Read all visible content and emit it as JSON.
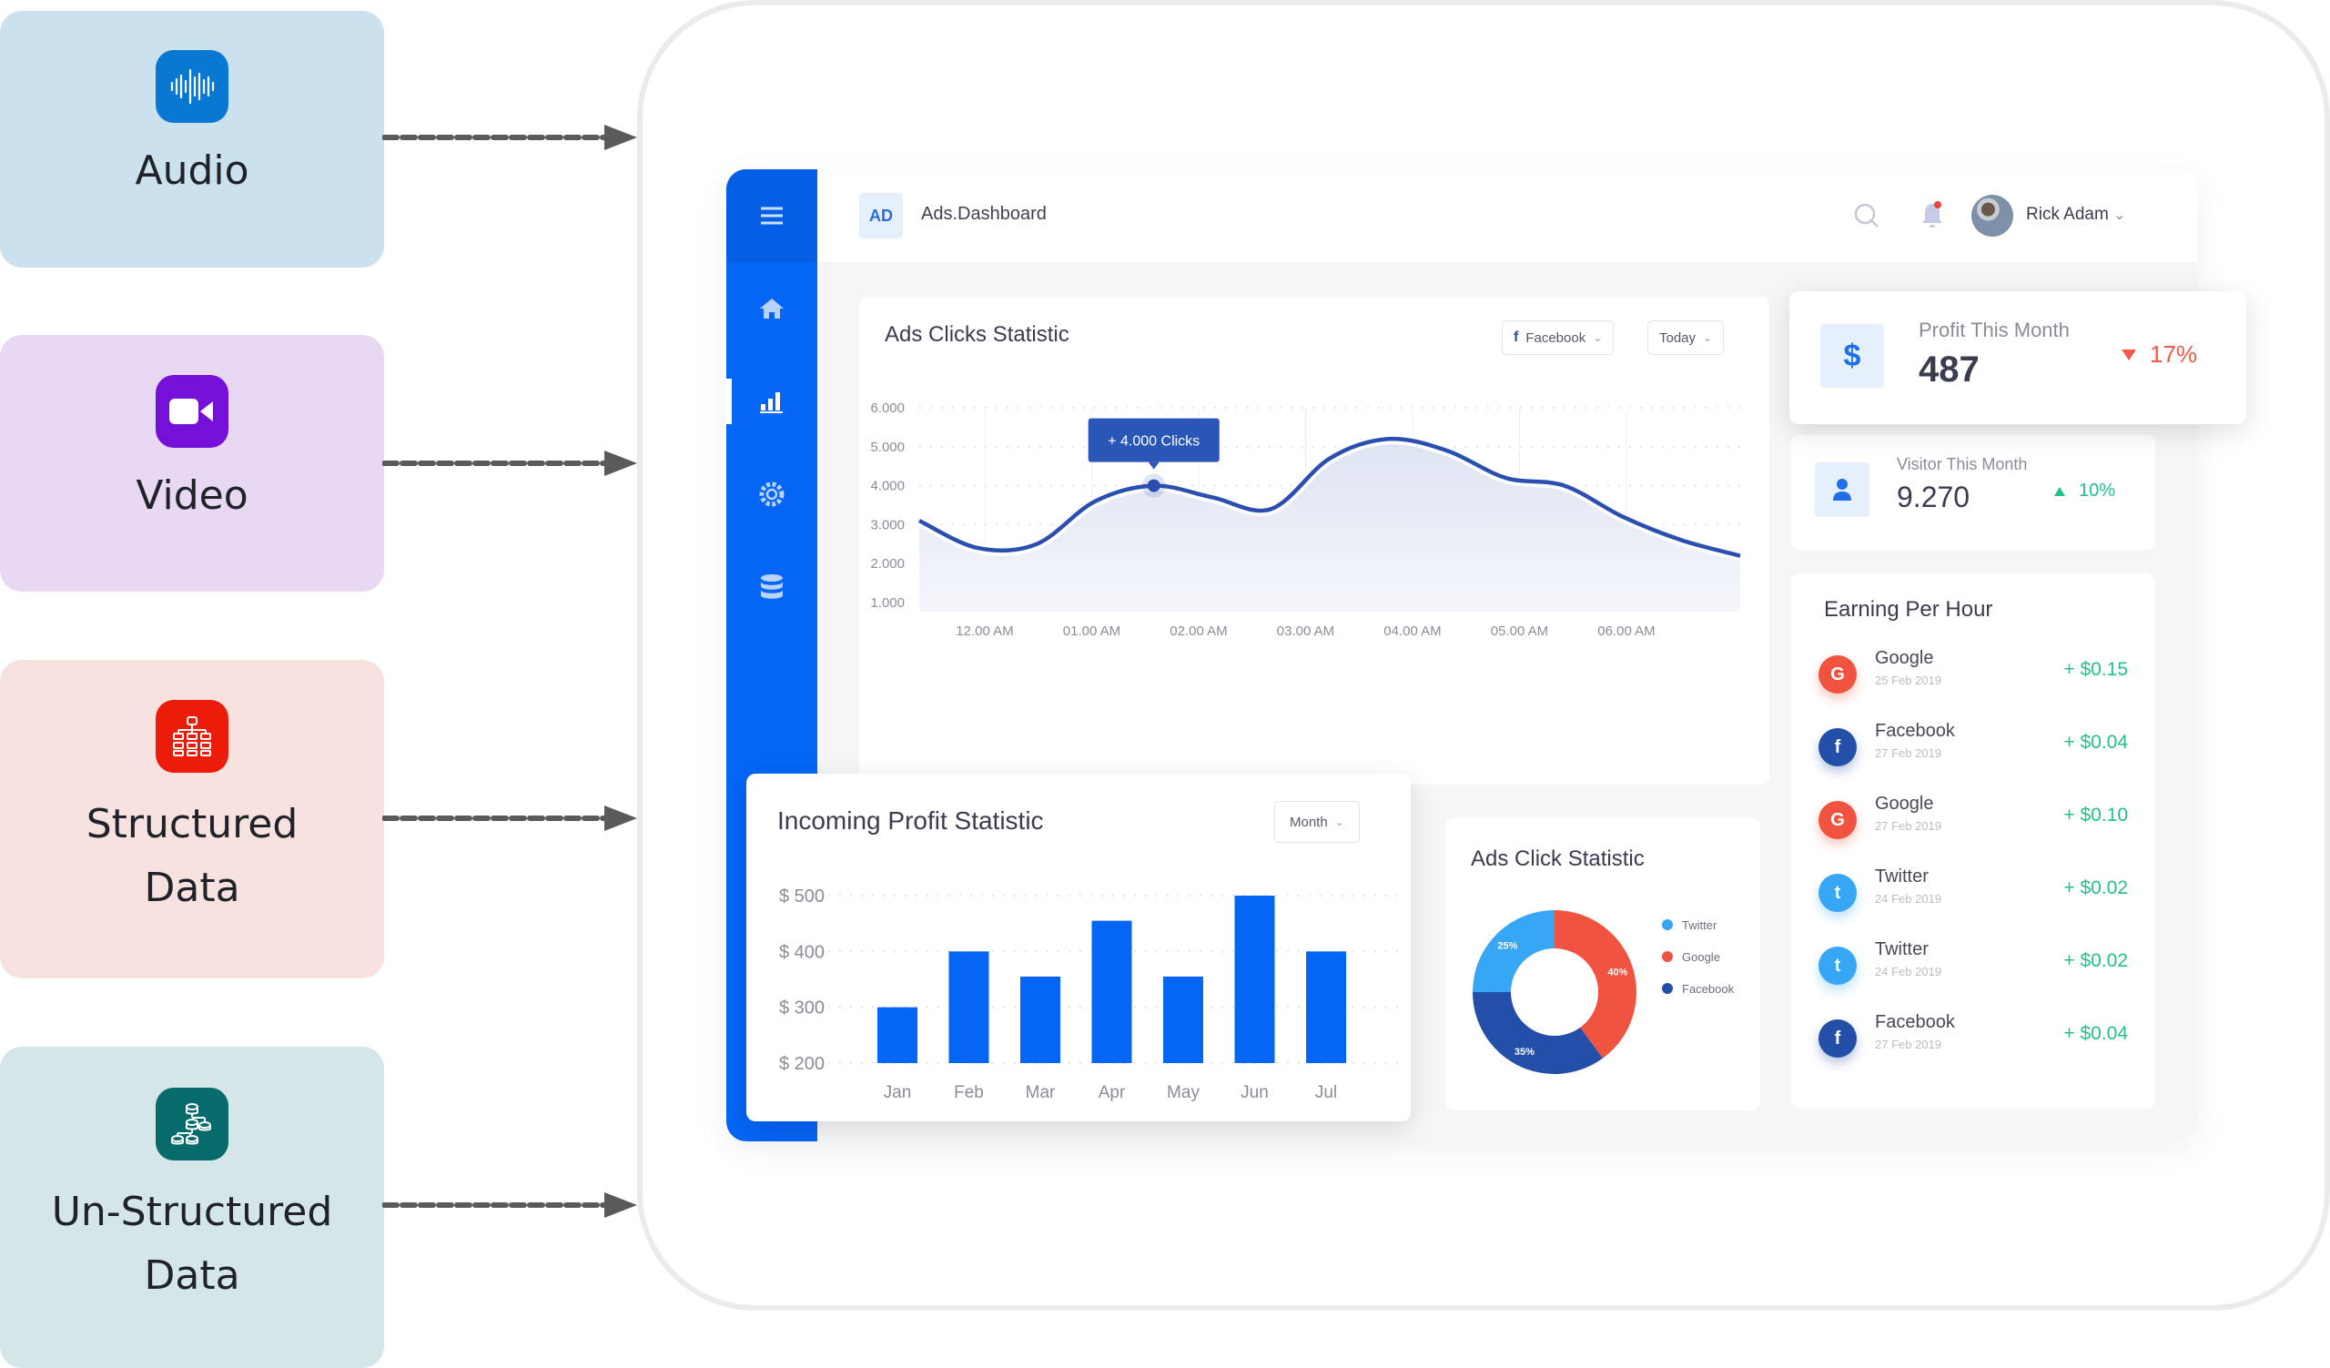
{
  "sources": [
    {
      "id": "audio",
      "label": "Audio",
      "icon": "audio-waveform-icon",
      "color": "#0978d2",
      "bg": "#cbe1ee"
    },
    {
      "id": "video",
      "label": "Video",
      "icon": "video-camera-icon",
      "color": "#7510d9",
      "bg": "#e8d8f3"
    },
    {
      "id": "structured",
      "label": "Structured Data",
      "label_lines": [
        "Structured",
        "Data"
      ],
      "icon": "structured-hierarchy-icon",
      "color": "#eb1c0a",
      "bg": "#f8e2df"
    },
    {
      "id": "unstructured",
      "label": "Un-Structured Data",
      "label_lines": [
        "Un-Structured",
        "Data"
      ],
      "icon": "unstructured-database-tree-icon",
      "color": "#076b6b",
      "bg": "#d4e6e8"
    }
  ],
  "dashboard": {
    "logo_badge": "AD",
    "app_title": "Ads.Dashboard",
    "user_name": "Rick Adam",
    "accent": "#0565f5",
    "sidebar": [
      {
        "icon": "menu-icon"
      },
      {
        "icon": "home-icon"
      },
      {
        "icon": "bar-chart-icon",
        "active": true
      },
      {
        "icon": "settings-gear-icon"
      },
      {
        "icon": "database-icon"
      }
    ],
    "ads_clicks": {
      "title": "Ads Clicks Statistic",
      "filter_source": "Facebook",
      "filter_period": "Today",
      "tooltip": "+ 4.000 Clicks"
    },
    "incoming_profit": {
      "title": "Incoming Profit Statistic",
      "filter": "Month"
    },
    "ads_click_pie": {
      "title": "Ads Click Statistic"
    },
    "profit_month": {
      "label": "Profit This Month",
      "value": "487",
      "delta": "17%",
      "direction": "down",
      "delta_color": "#ef5a4a"
    },
    "visitor_month": {
      "label": "Visitor This Month",
      "value": "9.270",
      "delta": "10%",
      "direction": "up",
      "delta_color": "#22c08a"
    },
    "earning_per_hour": {
      "title": "Earning Per Hour",
      "items": [
        {
          "source": "Google",
          "date": "25 Feb 2019",
          "amount": "+ $0.15",
          "icon": "google-icon",
          "color": "#f0533f",
          "glyph": "G"
        },
        {
          "source": "Facebook",
          "date": "27 Feb 2019",
          "amount": "+ $0.04",
          "icon": "facebook-icon",
          "color": "#244fa8",
          "glyph": "f"
        },
        {
          "source": "Google",
          "date": "27 Feb 2019",
          "amount": "+ $0.10",
          "icon": "google-icon",
          "color": "#f0533f",
          "glyph": "G"
        },
        {
          "source": "Twitter",
          "date": "24 Feb 2019",
          "amount": "+ $0.02",
          "icon": "twitter-icon",
          "color": "#37a6f4",
          "glyph": "t"
        },
        {
          "source": "Twitter",
          "date": "24 Feb 2019",
          "amount": "+ $0.02",
          "icon": "twitter-icon",
          "color": "#37a6f4",
          "glyph": "t"
        },
        {
          "source": "Facebook",
          "date": "27 Feb 2019",
          "amount": "+ $0.04",
          "icon": "facebook-icon",
          "color": "#244fa8",
          "glyph": "f"
        }
      ]
    }
  },
  "chart_data": [
    {
      "type": "line",
      "title": "Ads Clicks Statistic",
      "x": [
        "11.30 PM",
        "12.00 AM",
        "12.30 AM",
        "01.00 AM",
        "01.20 AM",
        "01.50 AM",
        "02.30 AM",
        "03.00 AM",
        "03.30 AM",
        "04.00 AM",
        "04.30 AM",
        "05.00 AM",
        "05.30 AM",
        "06.00 AM",
        "06.30 AM"
      ],
      "values": [
        3100,
        2400,
        2500,
        3600,
        4000,
        3700,
        3400,
        4700,
        5200,
        4900,
        4200,
        4000,
        3200,
        2600,
        2200
      ],
      "xticks": [
        "12.00 AM",
        "01.00 AM",
        "02.00 AM",
        "03.00 AM",
        "04.00 AM",
        "05.00 AM",
        "06.00 AM"
      ],
      "yticks": [
        "1.000",
        "2.000",
        "3.000",
        "4.000",
        "5.000",
        "6.000"
      ],
      "ylim": [
        1000,
        6000
      ],
      "highlight": {
        "x": "01.20 AM",
        "value": 4000,
        "label": "+ 4.000 Clicks"
      },
      "grid": true,
      "line_color": "#2a4fb0"
    },
    {
      "type": "bar",
      "title": "Incoming Profit Statistic",
      "categories": [
        "Jan",
        "Feb",
        "Mar",
        "Apr",
        "May",
        "Jun",
        "Jul"
      ],
      "values": [
        300,
        400,
        355,
        455,
        355,
        500,
        400
      ],
      "yticks": [
        "$ 200",
        "$ 300",
        "$ 400",
        "$ 500"
      ],
      "ylim": [
        200,
        500
      ],
      "grid": true,
      "bar_color": "#0565f5"
    },
    {
      "type": "pie",
      "title": "Ads Click Statistic",
      "donut": true,
      "slices": [
        {
          "label": "Twitter",
          "value": 25,
          "text": "25%",
          "color": "#37a6f4"
        },
        {
          "label": "Google",
          "value": 40,
          "text": "40%",
          "color": "#f0533f"
        },
        {
          "label": "Facebook",
          "value": 35,
          "text": "35%",
          "color": "#244fa8"
        }
      ],
      "legend": "right"
    }
  ]
}
